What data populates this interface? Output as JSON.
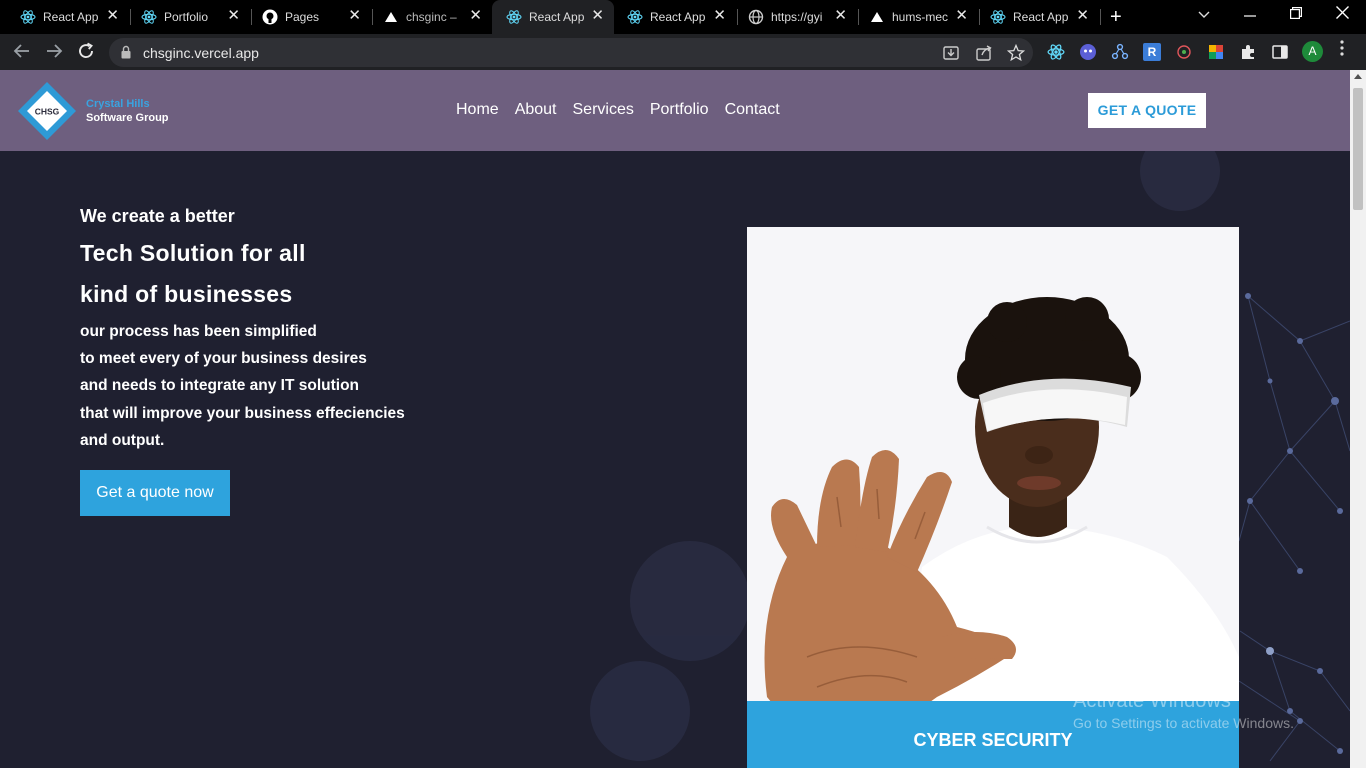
{
  "browser": {
    "tabs": [
      {
        "label": "React App",
        "icon": "react-icon",
        "active": false
      },
      {
        "label": "Portfolio",
        "icon": "react-icon",
        "active": false
      },
      {
        "label": "Pages",
        "icon": "github-icon",
        "active": false
      },
      {
        "label": "chsginc – (",
        "icon": "vercel-icon",
        "active": false
      },
      {
        "label": "React App",
        "icon": "react-icon",
        "active": true
      },
      {
        "label": "React App",
        "icon": "react-icon",
        "active": false
      },
      {
        "label": "https://gyi",
        "icon": "globe-icon",
        "active": false
      },
      {
        "label": "hums-mec",
        "icon": "vercel-icon",
        "active": false
      },
      {
        "label": "React App",
        "icon": "react-icon",
        "active": false
      }
    ],
    "url": "chsginc.vercel.app",
    "profile_initial": "A"
  },
  "site": {
    "logo": {
      "badge": "CHSG",
      "line1": "Crystal Hills",
      "line2": "Software Group"
    },
    "nav": [
      "Home",
      "About",
      "Services",
      "Portfolio",
      "Contact"
    ],
    "quote_button": "GET A QUOTE",
    "hero": {
      "eyebrow": "We create a better",
      "headline1": "Tech Solution for all",
      "headline2": "kind of businesses",
      "paragraph": [
        "our process has been simplified",
        "to meet every of your business desires",
        "and needs to integrate any IT solution",
        "that will improve your business effeciencies",
        "and output."
      ],
      "cta": "Get a quote now"
    },
    "card": {
      "caption": "CYBER SECURITY"
    }
  },
  "os": {
    "watermark_title": "Activate Windows",
    "watermark_sub": "Go to Settings to activate Windows."
  },
  "colors": {
    "header": "#6e5f7f",
    "accent": "#2ea3dd",
    "page_bg": "#1f2030"
  }
}
